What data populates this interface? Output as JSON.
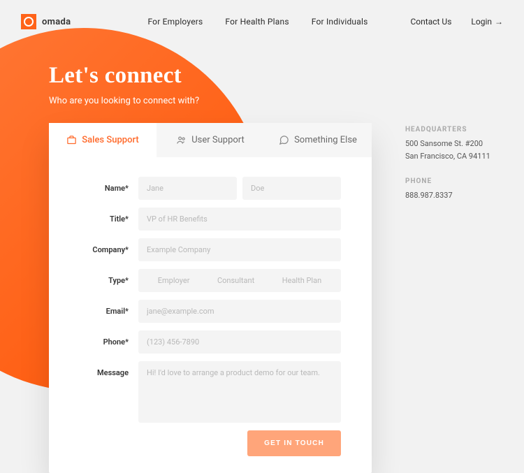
{
  "brand": {
    "name": "omada"
  },
  "nav": {
    "employers": "For Employers",
    "healthplans": "For Health Plans",
    "individuals": "For Individuals",
    "contact": "Contact Us",
    "login": "Login"
  },
  "hero": {
    "title": "Let's connect",
    "subtitle": "Who are you looking to connect with?"
  },
  "tabs": {
    "sales": "Sales Support",
    "user": "User Support",
    "other": "Something Else"
  },
  "form": {
    "labels": {
      "name": "Name*",
      "title": "Title*",
      "company": "Company*",
      "type": "Type*",
      "email": "Email*",
      "phone": "Phone*",
      "message": "Message"
    },
    "placeholders": {
      "firstname": "Jane",
      "lastname": "Doe",
      "title": "VP of HR Benefits",
      "company": "Example Company",
      "email": "jane@example.com",
      "phone": "(123) 456-7890",
      "message": "Hi! I'd love to arrange a product demo for our team."
    },
    "type_options": {
      "employer": "Employer",
      "consultant": "Consultant",
      "healthplan": "Health Plan"
    },
    "submit": "GET IN TOUCH"
  },
  "sidebar": {
    "hq_label": "HEADQUARTERS",
    "hq_line1": "500 Sansome St. #200",
    "hq_line2": "San Francisco, CA 94111",
    "phone_label": "PHONE",
    "phone_value": "888.987.8337"
  }
}
